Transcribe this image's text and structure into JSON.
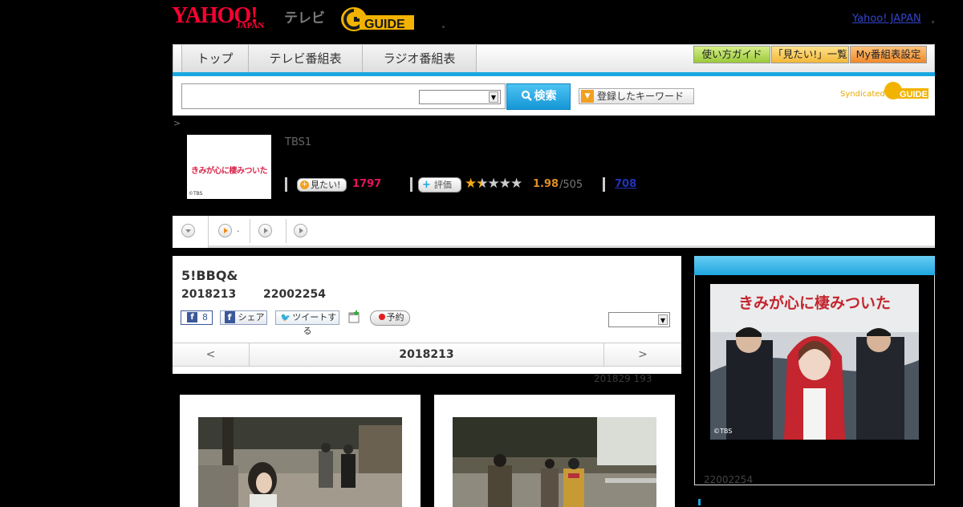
{
  "header": {
    "logo_yahoo": "YAHOO!",
    "logo_japan": "JAPAN",
    "logo_tv": "テレビ",
    "gguide_logo": "GUIDE",
    "top_link": "Yahoo! JAPAN"
  },
  "nav": {
    "tabs": [
      "トップ",
      "テレビ番組表",
      "ラジオ番組表"
    ],
    "right_buttons": [
      "使い方ガイド",
      "「見たい!」一覧",
      "My番組表設定"
    ]
  },
  "search": {
    "input_value": "",
    "button_label": "検索",
    "keyword_button_label": "登録したキーワード",
    "syndicated_label": "Syndicated",
    "syndicated_logo": "GUIDE"
  },
  "program": {
    "breadcrumb": ">",
    "thumb_caption": "きみが心に棲みついた",
    "thumb_copyright": "©TBS",
    "channel": "TBS1",
    "mitai_label": "見たい!",
    "mitai_count": "1797",
    "hyoka_label": "評価",
    "rating": "1.98",
    "rating_count": "/505",
    "rating_value": 1.98,
    "review_link": "708"
  },
  "tabs_row": {
    "tab2_suffix": "."
  },
  "episode": {
    "title": "5!BBQ&",
    "date": "2018213",
    "id": "22002254",
    "share_count": "8",
    "share_label": "シェア",
    "tweet_label": "ツイートする",
    "reserve_label": "予約",
    "pager_prev": "<",
    "pager_date": "2018213",
    "pager_next": ">",
    "updated": "201829  193"
  },
  "sidebar": {
    "poster_title": "きみが心に棲みついた",
    "poster_copyright": "©TBS",
    "id": "22002254"
  },
  "colors": {
    "accent": "#1aa7e0",
    "yahoo_red": "#ff0033",
    "mitai_pink": "#e4135f",
    "rating_orange": "#e08f27"
  }
}
